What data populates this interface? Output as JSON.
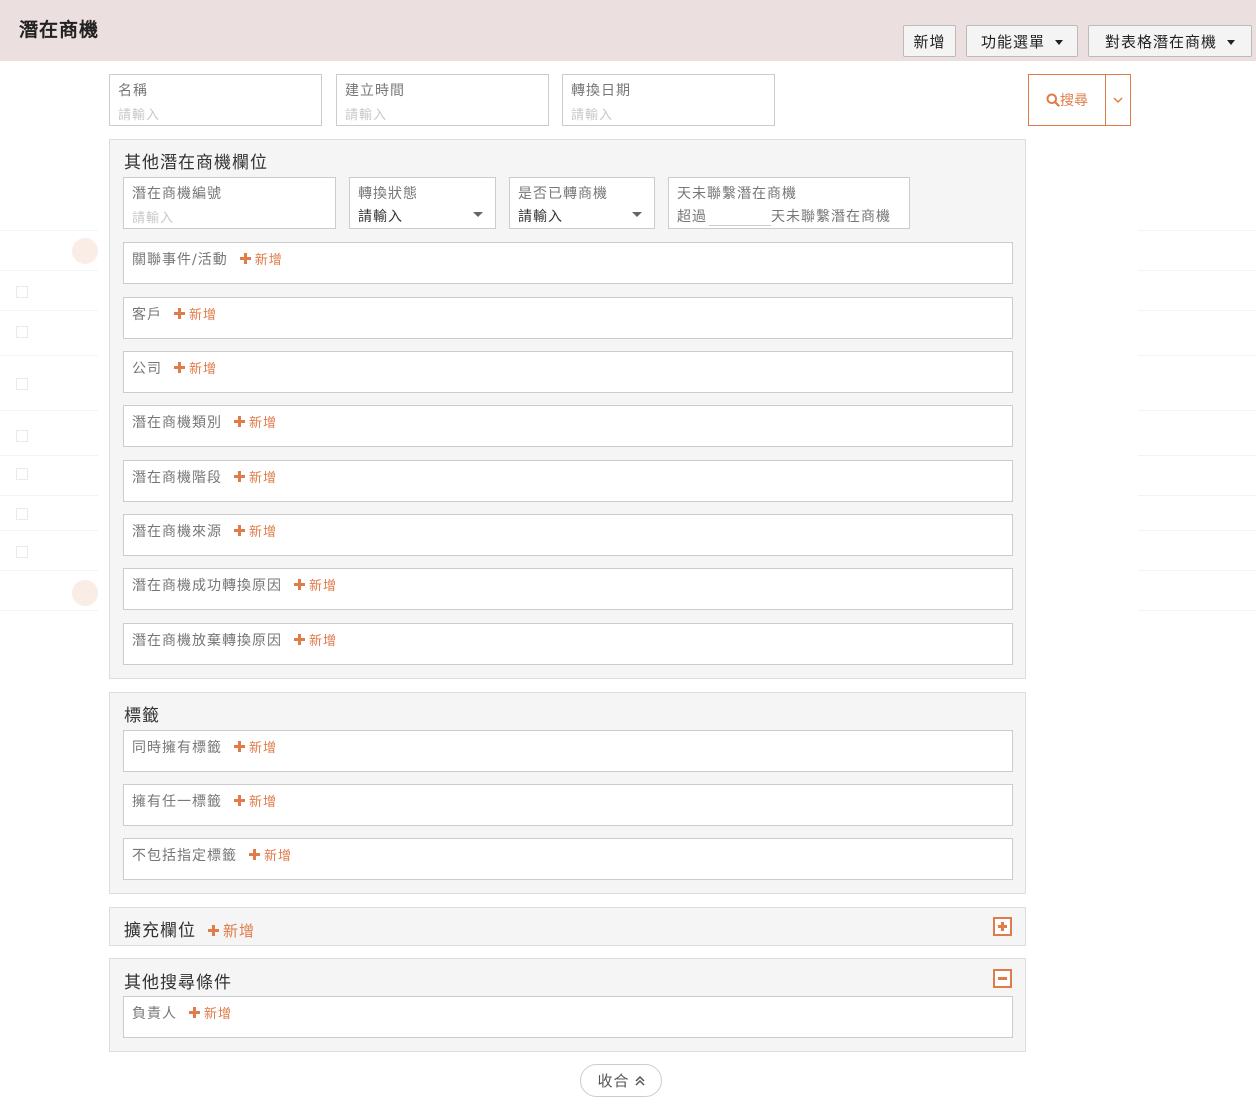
{
  "header": {
    "title": "潛在商機",
    "buttons": {
      "new": "新增",
      "function_menu": "功能選單",
      "table_menu": "對表格潛在商機"
    }
  },
  "search": {
    "fields": [
      {
        "label": "名稱",
        "placeholder": "請輸入"
      },
      {
        "label": "建立時間",
        "placeholder": "請輸入"
      },
      {
        "label": "轉換日期",
        "placeholder": "請輸入"
      }
    ],
    "button_label": "搜尋"
  },
  "other_fields": {
    "title": "其他潛在商機欄位",
    "lead_number": {
      "label": "潛在商機編號",
      "placeholder": "請輸入"
    },
    "conversion_status": {
      "label": "轉換狀態",
      "value": "請輸入"
    },
    "converted": {
      "label": "是否已轉商機",
      "value": "請輸入"
    },
    "not_contacted": {
      "label": "天未聯繫潛在商機",
      "prefix": "超過",
      "suffix": "天未聯繫潛在商機"
    },
    "rows": [
      {
        "label": "關聯事件/活動",
        "add": "新增"
      },
      {
        "label": "客戶",
        "add": "新增"
      },
      {
        "label": "公司",
        "add": "新增"
      },
      {
        "label": "潛在商機類別",
        "add": "新增"
      },
      {
        "label": "潛在商機階段",
        "add": "新增"
      },
      {
        "label": "潛在商機來源",
        "add": "新增"
      },
      {
        "label": "潛在商機成功轉換原因",
        "add": "新增"
      },
      {
        "label": "潛在商機放棄轉換原因",
        "add": "新增"
      }
    ]
  },
  "tags": {
    "title": "標籤",
    "rows": [
      {
        "label": "同時擁有標籤",
        "add": "新增"
      },
      {
        "label": "擁有任一標籤",
        "add": "新增"
      },
      {
        "label": "不包括指定標籤",
        "add": "新增"
      }
    ]
  },
  "extended": {
    "title": "擴充欄位",
    "add": "新增"
  },
  "other_search": {
    "title": "其他搜尋條件",
    "rows": [
      {
        "label": "負責人",
        "add": "新增"
      }
    ]
  },
  "collapse_label": "收合",
  "colors": {
    "accent": "#e07b4a",
    "header_bg": "#ecdfdf",
    "group_bg": "#f5f5f5"
  },
  "icons": {
    "search": "search-icon",
    "dropdown": "chevron-down-icon",
    "collapse": "double-chevron-up-icon"
  }
}
